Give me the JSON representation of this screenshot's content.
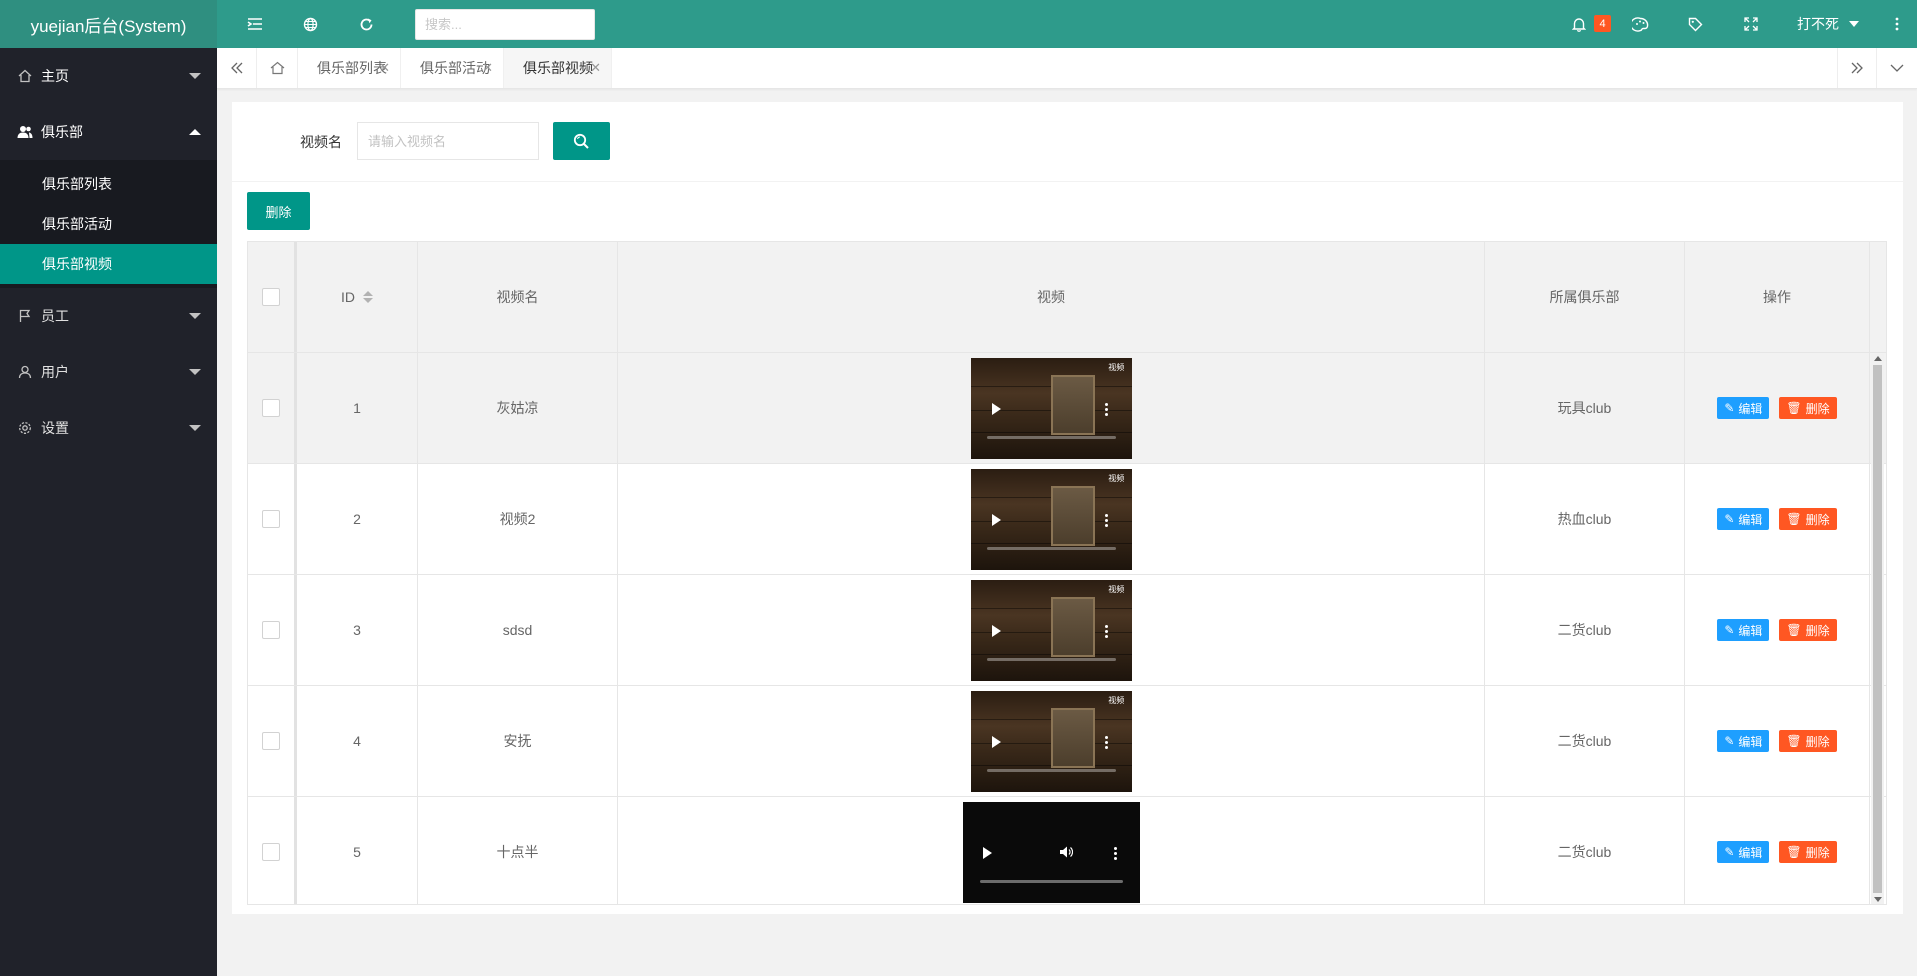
{
  "app": {
    "title": "yuejian后台(System)"
  },
  "sidebar": {
    "items": [
      {
        "label": "主页"
      },
      {
        "label": "俱乐部"
      },
      {
        "label": "员工"
      },
      {
        "label": "用户"
      },
      {
        "label": "设置"
      }
    ],
    "subitems": [
      {
        "label": "俱乐部列表"
      },
      {
        "label": "俱乐部活动"
      },
      {
        "label": "俱乐部视频"
      }
    ]
  },
  "header": {
    "search_placeholder": "搜索...",
    "notification_count": "4",
    "user_name": "打不死"
  },
  "tabs": [
    {
      "label": "俱乐部列表"
    },
    {
      "label": "俱乐部活动"
    },
    {
      "label": "俱乐部视频"
    }
  ],
  "filter": {
    "label": "视频名",
    "placeholder": "请输入视频名",
    "delete_label": "删除"
  },
  "table": {
    "headers": {
      "id": "ID",
      "name": "视频名",
      "video": "视频",
      "club": "所属俱乐部",
      "op": "操作"
    },
    "edit_label": "编辑",
    "delete_label": "删除",
    "rows": [
      {
        "id": "1",
        "name": "灰姑凉",
        "club": "玩具club"
      },
      {
        "id": "2",
        "name": "视频2",
        "club": "热血club"
      },
      {
        "id": "3",
        "name": "sdsd",
        "club": "二货club"
      },
      {
        "id": "4",
        "name": "安抚",
        "club": "二货club"
      },
      {
        "id": "5",
        "name": "十点半",
        "club": "二货club"
      }
    ]
  },
  "colors": {
    "primary": "#009688",
    "header": "#2e9b8b",
    "sidebar": "#20222a",
    "edit": "#1e9fff",
    "danger": "#ff5722"
  }
}
